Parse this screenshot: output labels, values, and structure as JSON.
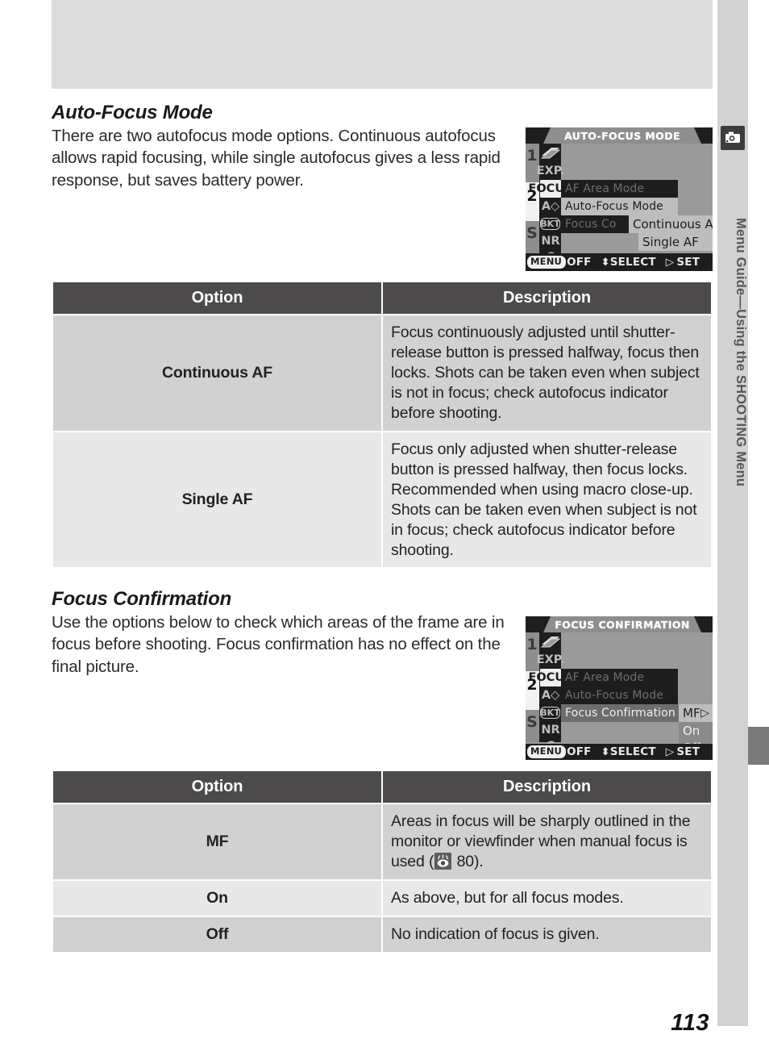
{
  "sidebar": {
    "icon": "camera-icon",
    "vertical_label": "Menu Guide—Using the SHOOTING Menu"
  },
  "page_number": "113",
  "sections": [
    {
      "title": "Auto-Focus Mode",
      "body": "There are two autofocus mode options. Continuous autofocus allows rapid focusing, while single autofocus gives a less rapid response, but saves battery power."
    },
    {
      "title": "Focus Confirmation",
      "body": "Use the options below to check which areas of the frame are in focus before shooting. Focus confirmation has no effect on the final picture."
    }
  ],
  "lcd_screens": [
    {
      "title": "AUTO-FOCUS MODE",
      "icon_column": [
        "EXP.",
        "FOCUS",
        "A◇",
        "BKT",
        "NR",
        "C"
      ],
      "page_marks": [
        "1",
        "2",
        "S"
      ],
      "selected_icon": "FOCUS",
      "menu_rows": [
        {
          "label": "AF Area Mode",
          "state": "dim"
        },
        {
          "label": "Auto-Focus Mode",
          "state": "highlight"
        },
        {
          "label": "Focus Co",
          "state": "dim"
        }
      ],
      "flyout": [
        {
          "label": "Continuous AF",
          "selected": true,
          "arrow": "▷"
        },
        {
          "label": "Single AF",
          "selected": false
        }
      ],
      "footer": {
        "menu_pill": "MENU",
        "off": "OFF",
        "select_glyph": "⬍",
        "select": "SELECT",
        "set_glyph": "▷",
        "set": "SET"
      }
    },
    {
      "title": "FOCUS CONFIRMATION",
      "icon_column": [
        "EXP.",
        "FOCUS",
        "A◇",
        "BKT",
        "NR",
        "C"
      ],
      "page_marks": [
        "1",
        "2",
        "S"
      ],
      "selected_icon": "FOCUS",
      "menu_rows": [
        {
          "label": "AF Area Mode",
          "state": "dim"
        },
        {
          "label": "Auto-Focus Mode",
          "state": "dim"
        },
        {
          "label": "Focus Confirmation",
          "state": "highlight"
        }
      ],
      "flyout": [
        {
          "label": "MF",
          "selected": true,
          "arrow": "▷"
        },
        {
          "label": "On",
          "selected": false
        },
        {
          "label": "Off",
          "selected": false
        }
      ],
      "footer": {
        "menu_pill": "MENU",
        "off": "OFF",
        "select_glyph": "⬍",
        "select": "SELECT",
        "set_glyph": "▷",
        "set": "SET"
      }
    }
  ],
  "tables": [
    {
      "headers": {
        "option": "Option",
        "description": "Description"
      },
      "rows": [
        {
          "option": "Continuous AF",
          "description": "Focus continuously adjusted until shutter-release button is pressed halfway, focus then locks. Shots can be taken even when subject is not in focus; check autofocus indicator before shooting."
        },
        {
          "option": "Single AF",
          "description": "Focus only adjusted when shutter-release button is pressed halfway, then focus locks. Recommended when using macro close-up.   Shots can be taken even when subject is not in focus; check autofocus indicator before shooting."
        }
      ]
    },
    {
      "headers": {
        "option": "Option",
        "description": "Description"
      },
      "rows": [
        {
          "option": "MF",
          "description_before": "Areas in focus will be sharply outlined in the monitor or viewfinder when manual focus is used (",
          "reference_icon": "eye-reference-icon",
          "description_page": " 80).",
          "description_after": ""
        },
        {
          "option": "On",
          "description": "As above, but for all focus modes."
        },
        {
          "option": "Off",
          "description": "No indication of focus is given."
        }
      ]
    }
  ]
}
